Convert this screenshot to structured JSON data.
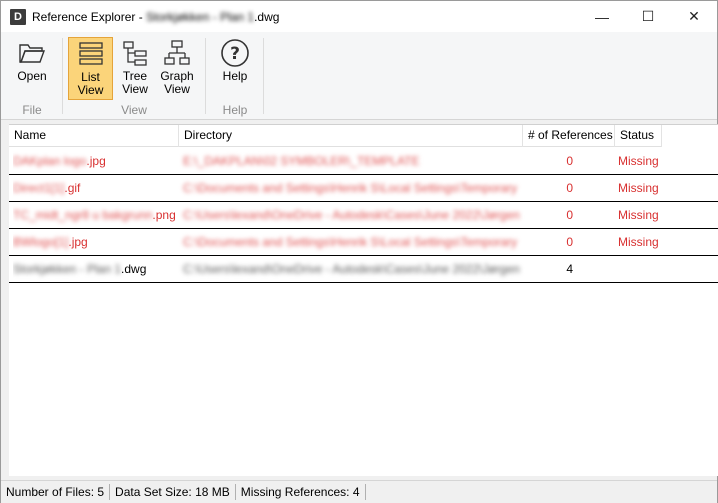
{
  "window": {
    "icon_letter": "D",
    "title_prefix": "Reference Explorer - ",
    "title_blurred": "Storkjøkken - Plan 1",
    "title_suffix": ".dwg",
    "minimize": "—",
    "maximize": "☐",
    "close": "✕"
  },
  "ribbon": {
    "groups": [
      {
        "label": "File",
        "buttons": [
          {
            "label": "Open"
          }
        ]
      },
      {
        "label": "View",
        "buttons": [
          {
            "label1": "List",
            "label2": "View"
          },
          {
            "label1": "Tree",
            "label2": "View"
          },
          {
            "label1": "Graph",
            "label2": "View"
          }
        ]
      },
      {
        "label": "Help",
        "buttons": [
          {
            "label": "Help"
          }
        ]
      }
    ],
    "active_button": "List View"
  },
  "table": {
    "columns": [
      "Name",
      "Directory",
      "# of References",
      "Status"
    ],
    "rows": [
      {
        "name_blurred": "DAKplan logo",
        "name_ext": ".jpg",
        "dir": "E:\\_DAKPLAN\\02 SYMBOLER\\_TEMPLATE",
        "refs": "0",
        "status": "Missing"
      },
      {
        "name_blurred": "Direct1[1]",
        "name_ext": ".gif",
        "dir": "C:\\Documents and Settings\\Henrik S\\Local Settings\\Temporary",
        "refs": "0",
        "status": "Missing"
      },
      {
        "name_blurred": "TC_midt_ngr8 u bakgrunn",
        "name_ext": ".png",
        "dir": "C:\\Users\\lexand\\OneDrive - Autodesk\\Cases\\June 2022\\Jørgen",
        "refs": "0",
        "status": "Missing"
      },
      {
        "name_blurred": "BWlogo[1]",
        "name_ext": ".jpg",
        "dir": "C:\\Documents and Settings\\Henrik S\\Local Settings\\Temporary",
        "refs": "0",
        "status": "Missing"
      },
      {
        "name_blurred": "Storkjøkken - Plan 1",
        "name_ext": ".dwg",
        "dir": "C:\\Users\\lexand\\OneDrive - Autodesk\\Cases\\June 2022\\Jørgen",
        "refs": "4",
        "status": ""
      }
    ]
  },
  "status_bar": {
    "files": "Number of Files: 5",
    "size": "Data Set Size: 18 MB",
    "missing": "Missing References: 4"
  },
  "colors": {
    "missing": "#d83030",
    "active_button": "#fbd47a"
  }
}
